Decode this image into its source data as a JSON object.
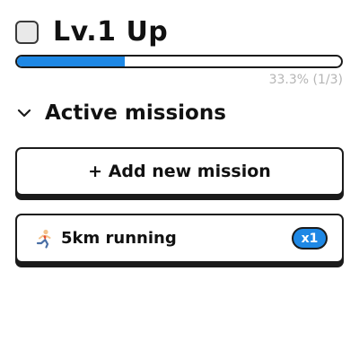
{
  "level": {
    "title": "Lv.1 Up",
    "checked": false
  },
  "progress": {
    "fraction": 0.333,
    "text": "33.3% (1/3)",
    "fill_color": "#1e88e5"
  },
  "missions_section": {
    "title": "Active missions",
    "expanded": true,
    "chevron_icon": "chevron-down-icon",
    "add_button_label": "+ Add new mission",
    "items": [
      {
        "name": "5km running",
        "icon": "person-running-icon",
        "count_label": "x1"
      }
    ]
  },
  "colors": {
    "accent": "#1e88e5",
    "border": "#1b1b1b",
    "muted_text": "#b5b5b5"
  }
}
